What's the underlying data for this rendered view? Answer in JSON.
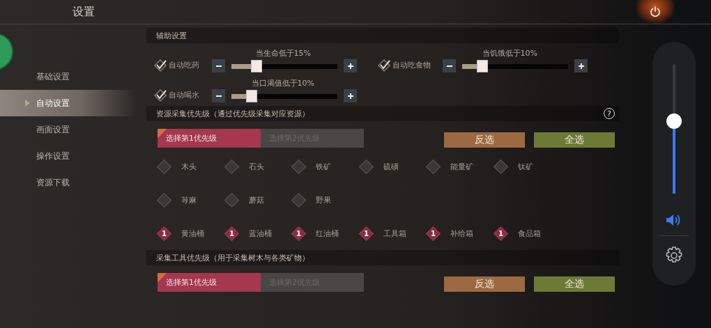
{
  "header": {
    "title": "设置"
  },
  "sidebar": {
    "items": [
      {
        "label": "基础设置",
        "selected": false
      },
      {
        "label": "自动设置",
        "selected": true
      },
      {
        "label": "画面设置",
        "selected": false
      },
      {
        "label": "操作设置",
        "selected": false
      },
      {
        "label": "资源下载",
        "selected": false
      }
    ]
  },
  "assist": {
    "title": "辅助设置",
    "items": [
      {
        "label": "自动吃药",
        "checked": true,
        "reading": "当生命低于15%",
        "level": 0.19
      },
      {
        "label": "自动吃食物",
        "checked": true,
        "reading": "当饥饿低于10%",
        "level": 0.15
      },
      {
        "label": "自动喝水",
        "checked": true,
        "reading": "当口渴值低于10%",
        "level": 0.15
      }
    ]
  },
  "resource": {
    "title": "资源采集优先级（通过优先级采集对应资源）",
    "help": "?",
    "tabs": [
      {
        "label": "选择第1优先级",
        "selected": true
      },
      {
        "label": "选择第2优先级",
        "selected": false
      }
    ],
    "buttons": [
      {
        "label": "反选",
        "kind": "invert"
      },
      {
        "label": "全选",
        "kind": "all"
      }
    ],
    "rows": [
      [
        {
          "label": "木头",
          "checked": false
        },
        {
          "label": "石头",
          "checked": false
        },
        {
          "label": "铁矿",
          "checked": false
        },
        {
          "label": "硫磺",
          "checked": false
        },
        {
          "label": "能量矿",
          "checked": false
        },
        {
          "label": "钛矿",
          "checked": false
        }
      ],
      [
        {
          "label": "荨麻",
          "checked": false
        },
        {
          "label": "蘑菇",
          "checked": false
        },
        {
          "label": "野果",
          "checked": false
        }
      ],
      [
        {
          "label": "黄油桶",
          "checked": true,
          "badge": "1"
        },
        {
          "label": "蓝油桶",
          "checked": true,
          "badge": "1"
        },
        {
          "label": "红油桶",
          "checked": true,
          "badge": "1"
        },
        {
          "label": "工具箱",
          "checked": true,
          "badge": "1"
        },
        {
          "label": "补给箱",
          "checked": true,
          "badge": "1"
        },
        {
          "label": "食品箱",
          "checked": true,
          "badge": "1"
        }
      ]
    ]
  },
  "tools": {
    "title": "采集工具优先级（用于采集树木与各类矿物）",
    "tabs": [
      {
        "label": "选择第1优先级",
        "selected": true
      },
      {
        "label": "选择第2优先级",
        "selected": false
      }
    ],
    "buttons": [
      {
        "label": "反选",
        "kind": "invert"
      },
      {
        "label": "全选",
        "kind": "all"
      }
    ]
  },
  "volume": {
    "level": 0.56
  }
}
